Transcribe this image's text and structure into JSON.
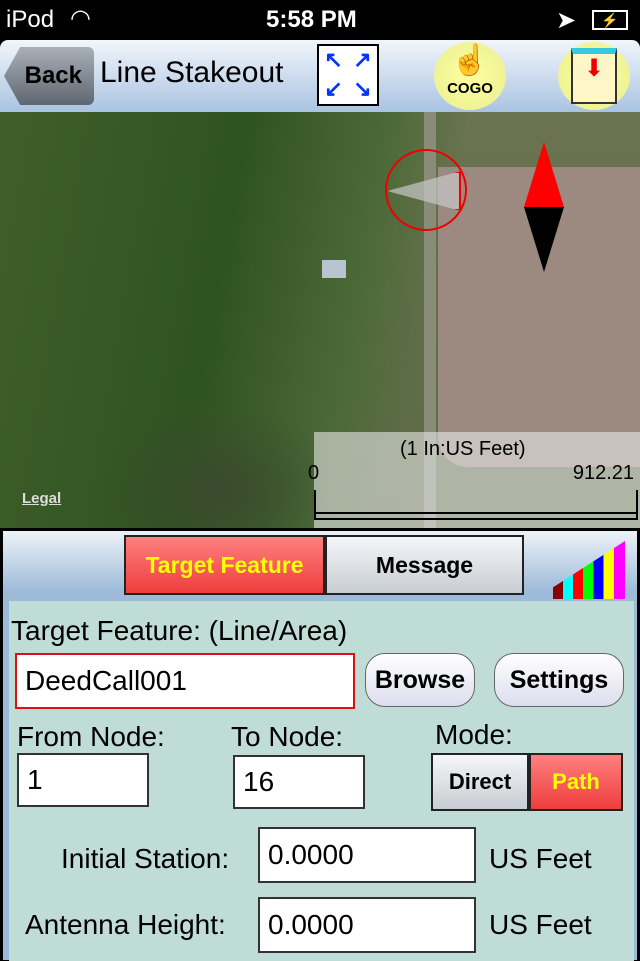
{
  "status": {
    "carrier": "iPod",
    "time": "5:58 PM"
  },
  "nav": {
    "back": "Back",
    "title": "Line Stakeout",
    "cogo": "COGO"
  },
  "map": {
    "legal": "Legal",
    "scale_units": "(1 In:US Feet)",
    "scale_min": "0",
    "scale_max": "912.21"
  },
  "tabs": {
    "target": "Target Feature",
    "message": "Message",
    "active": "Target Feature"
  },
  "form": {
    "target_label": "Target Feature: (Line/Area)",
    "target_value": "DeedCall001",
    "browse": "Browse",
    "settings": "Settings",
    "from_label": "From Node:",
    "from_value": "1",
    "to_label": "To Node:",
    "to_value": "16",
    "mode_label": "Mode:",
    "mode_direct": "Direct",
    "mode_path": "Path",
    "mode_selected": "Path",
    "station_label": "Initial Station:",
    "station_value": "0.0000",
    "station_unit": "US Feet",
    "antenna_label": "Antenna Height:",
    "antenna_value": "0.0000",
    "antenna_unit": "US Feet"
  },
  "colors": {
    "active_tab": "#f25555",
    "active_text": "#ffff00",
    "field_border_active": "#dd1111"
  }
}
